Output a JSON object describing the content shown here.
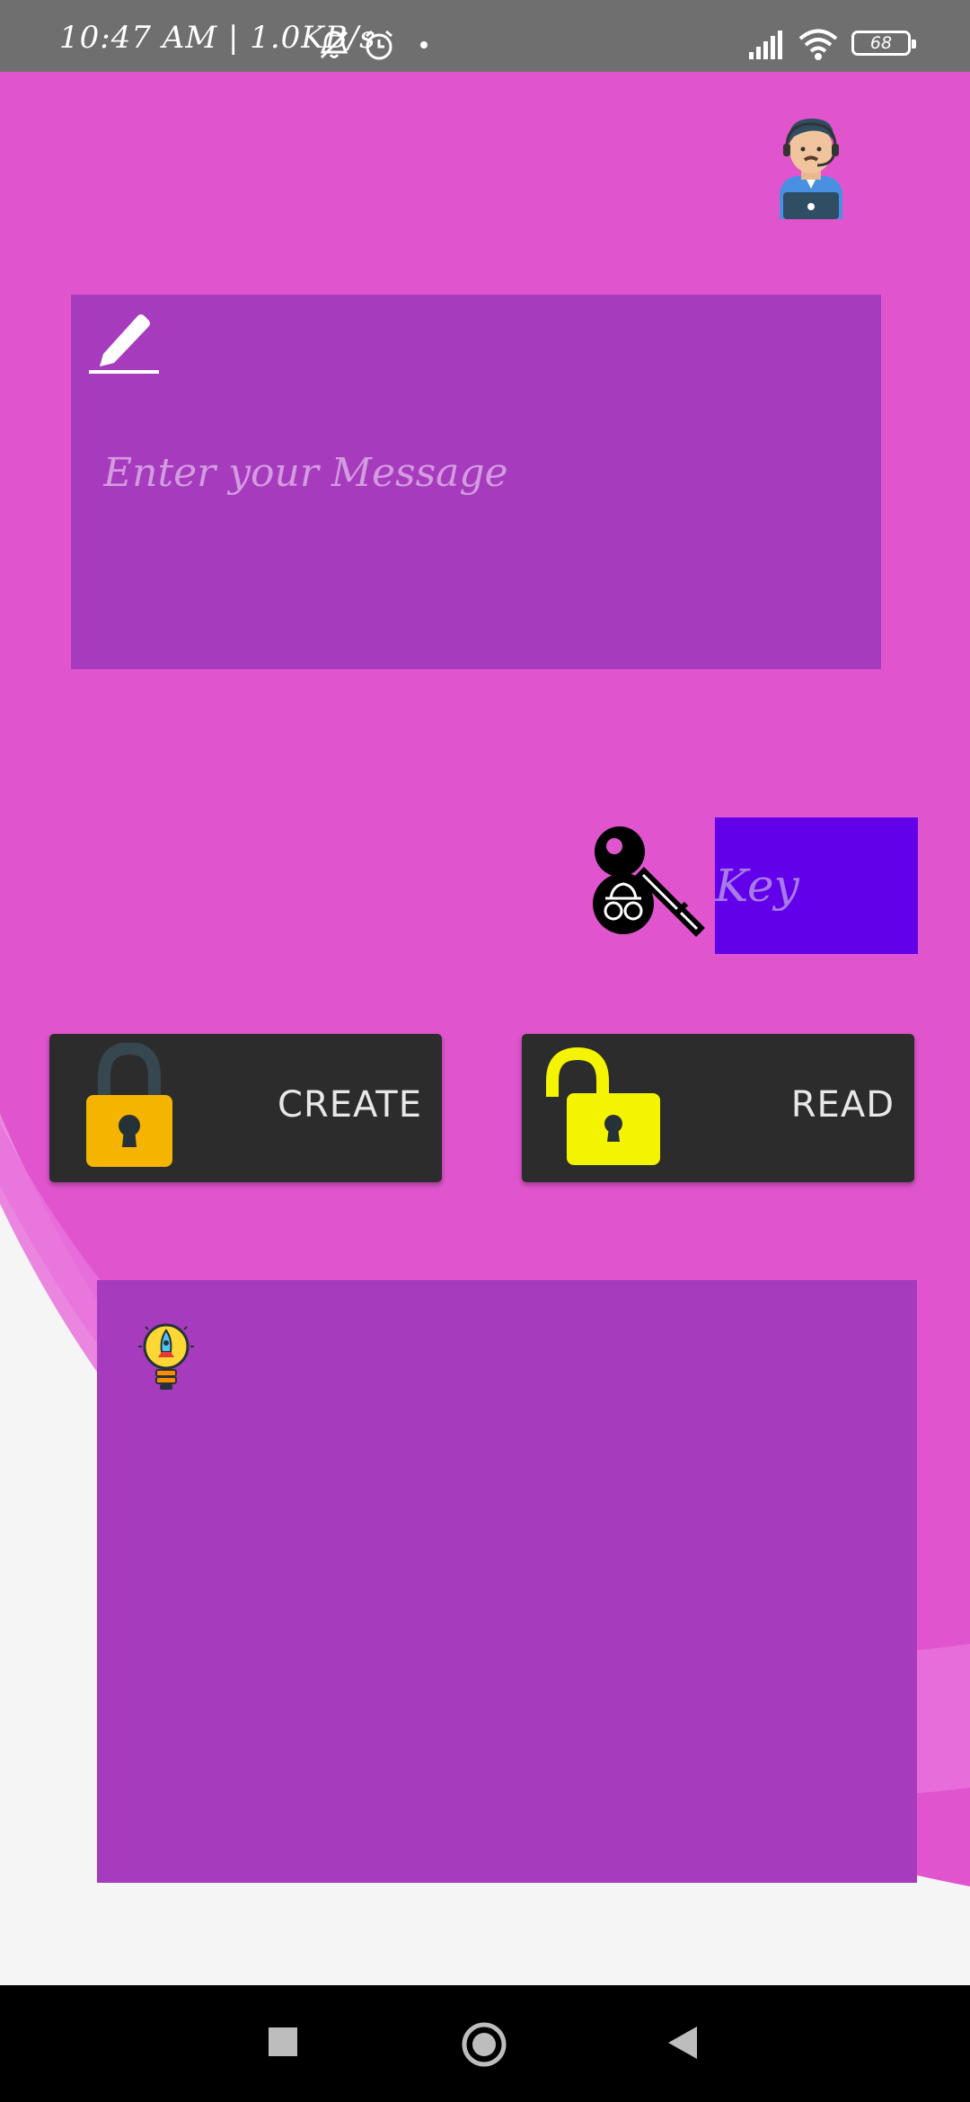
{
  "status_bar": {
    "time_text": "10:47 AM | 1.0KB/s",
    "battery_level": "68",
    "icons": [
      "mute-bell-icon",
      "alarm-icon",
      "dot-icon",
      "signal-icon",
      "wifi-icon",
      "battery-icon"
    ]
  },
  "colors": {
    "background": "#e055ce",
    "card": "#a63bbd",
    "key_field": "#6200ea",
    "button": "#2c2c2c",
    "status_bar": "#6f6f6f",
    "nav_bar": "#000000"
  },
  "header": {
    "avatar_icon": "support-agent-icon"
  },
  "message": {
    "icon": "pencil-icon",
    "value": "",
    "placeholder": "Enter your Message"
  },
  "key": {
    "icon": "key-spy-icon",
    "value": "",
    "placeholder": "Key"
  },
  "actions": {
    "create_label": "CREATE",
    "create_icon": "locked-padlock-icon",
    "read_label": "READ",
    "read_icon": "unlocked-padlock-icon"
  },
  "output": {
    "icon": "lightbulb-rocket-icon",
    "text": ""
  },
  "nav": {
    "icons": [
      "recents-square-icon",
      "home-circle-icon",
      "back-triangle-icon"
    ]
  }
}
